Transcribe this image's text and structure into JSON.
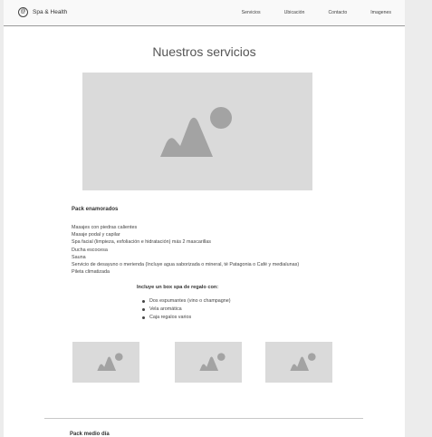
{
  "navbar": {
    "logo_glyph": "@",
    "brand": "Spa & Health",
    "links": [
      "Servicios",
      "Ubicación",
      "Contacto",
      "Imagenes"
    ]
  },
  "main": {
    "title": "Nuestros servicios",
    "hero_image_icon": "image-placeholder-icon",
    "sections": [
      {
        "title": "Pack enamorados",
        "services": [
          "Masajes con piedras calientes",
          "Masaje podal y capilar",
          "Spa facial (limpieza, exfoliación e hidratación) más 2 mascarillas",
          "Ducha escocesa",
          "Sauna",
          "Servicio de desayuno o merienda (Incluye agua saborizada o mineral, té Patagonia o Café y medialunas)",
          "Pileta climatizada"
        ],
        "gift_title": "Incluye un box spa de regalo con:",
        "gift_items": [
          "Dos espumantes (vino o champagne)",
          "Vela aromática",
          "Caja regalos varios"
        ]
      },
      {
        "title": "Pack medio día"
      }
    ]
  },
  "colors": {
    "placeholder_bg": "#dadada",
    "placeholder_icon": "#a3a3a3",
    "page_bg": "#ececec"
  }
}
